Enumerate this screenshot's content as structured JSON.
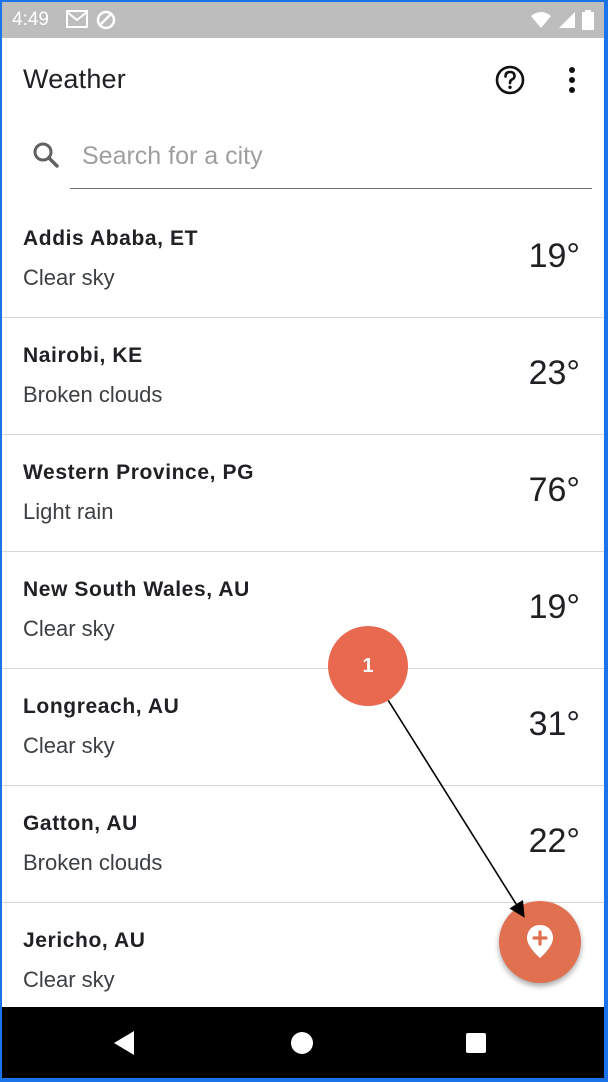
{
  "status_bar": {
    "time": "4:49",
    "left_icons": [
      "gmail-icon",
      "sync-icon"
    ],
    "right_icons": [
      "wifi-icon",
      "signal-icon",
      "battery-icon"
    ],
    "color": "#bdbdbd"
  },
  "app_bar": {
    "title": "Weather",
    "icons": [
      "help-icon",
      "more-vert-icon"
    ]
  },
  "search": {
    "placeholder": "Search for a city",
    "value": ""
  },
  "cities": [
    {
      "name": "Addis Ababa, ET",
      "description": "Clear sky",
      "temperature": "19°"
    },
    {
      "name": "Nairobi, KE",
      "description": "Broken clouds",
      "temperature": "23°"
    },
    {
      "name": "Western Province, PG",
      "description": "Light rain",
      "temperature": "76°"
    },
    {
      "name": "New South Wales, AU",
      "description": "Clear sky",
      "temperature": "19°"
    },
    {
      "name": "Longreach, AU",
      "description": "Clear sky",
      "temperature": "31°"
    },
    {
      "name": "Gatton, AU",
      "description": "Broken clouds",
      "temperature": "22°"
    },
    {
      "name": "Jericho, AU",
      "description": "Clear sky",
      "temperature": ""
    }
  ],
  "fab": {
    "icon": "add-location-icon",
    "color": "#e07050"
  },
  "annotation": {
    "label": "1",
    "color": "#e8694f"
  },
  "nav_bar": {
    "icons": [
      "back-icon",
      "home-icon",
      "recents-icon"
    ]
  }
}
